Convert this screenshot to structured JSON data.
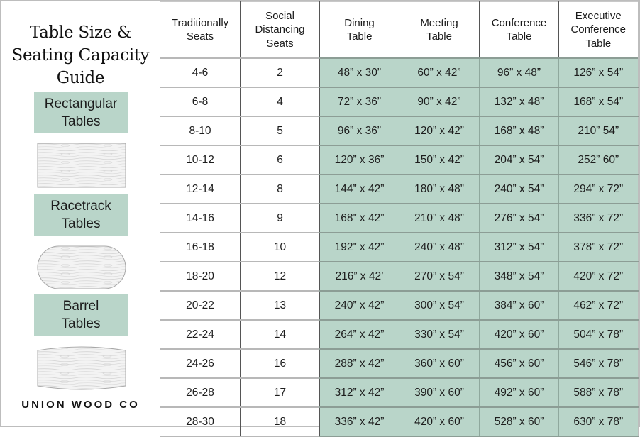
{
  "title_lines": [
    "Table Size &",
    "Seating Capacity",
    "Guide"
  ],
  "brand": "UNION WOOD CO",
  "categories": [
    {
      "line1": "Rectangular",
      "line2": "Tables",
      "shape": "rectangle-table-icon"
    },
    {
      "line1": "Racetrack",
      "line2": "Tables",
      "shape": "racetrack-table-icon"
    },
    {
      "line1": "Barrel",
      "line2": "Tables",
      "shape": "barrel-table-icon"
    }
  ],
  "colors": {
    "accent": "#b9d5c9",
    "border": "#bdbdbd",
    "text": "#1a1a1a"
  },
  "table": {
    "headers": [
      [
        "Traditionally",
        "Seats"
      ],
      [
        "Social",
        "Distancing",
        "Seats"
      ],
      [
        "Dining",
        "Table"
      ],
      [
        "Meeting",
        "Table"
      ],
      [
        "Conference",
        "Table"
      ],
      [
        "Executive",
        "Conference",
        "Table"
      ]
    ],
    "rows": [
      [
        "4-6",
        "2",
        "48” x 30”",
        "60” x 42”",
        "96” x 48”",
        "126” x 54”"
      ],
      [
        "6-8",
        "4",
        "72” x 36”",
        "90” x 42”",
        "132” x 48”",
        "168” x 54”"
      ],
      [
        "8-10",
        "5",
        "96” x 36”",
        "120” x 42”",
        "168” x 48”",
        "210” 54”"
      ],
      [
        "10-12",
        "6",
        "120” x 36”",
        "150” x 42”",
        "204” x 54”",
        "252” 60”"
      ],
      [
        "12-14",
        "8",
        "144” x 42”",
        "180” x 48”",
        "240” x 54”",
        "294” x 72”"
      ],
      [
        "14-16",
        "9",
        "168” x 42”",
        "210” x 48”",
        "276” x 54”",
        "336” x 72”"
      ],
      [
        "16-18",
        "10",
        "192” x 42”",
        "240” x 48”",
        "312” x 54”",
        "378” x 72”"
      ],
      [
        "18-20",
        "12",
        "216” x 42’",
        "270” x 54”",
        "348” x 54”",
        "420” x 72”"
      ],
      [
        "20-22",
        "13",
        "240” x 42”",
        "300” x 54”",
        "384” x 60”",
        "462” x 72”"
      ],
      [
        "22-24",
        "14",
        "264” x 42”",
        "330” x 54”",
        "420” x 60”",
        "504” x 78”"
      ],
      [
        "24-26",
        "16",
        "288” x 42”",
        "360” x 60”",
        "456” x 60”",
        "546” x 78”"
      ],
      [
        "26-28",
        "17",
        "312” x 42”",
        "390” x 60”",
        "492” x 60”",
        "588” x 78”"
      ],
      [
        "28-30",
        "18",
        "336” x 42”",
        "420” x 60”",
        "528” x 60”",
        "630” x 78”"
      ]
    ]
  }
}
